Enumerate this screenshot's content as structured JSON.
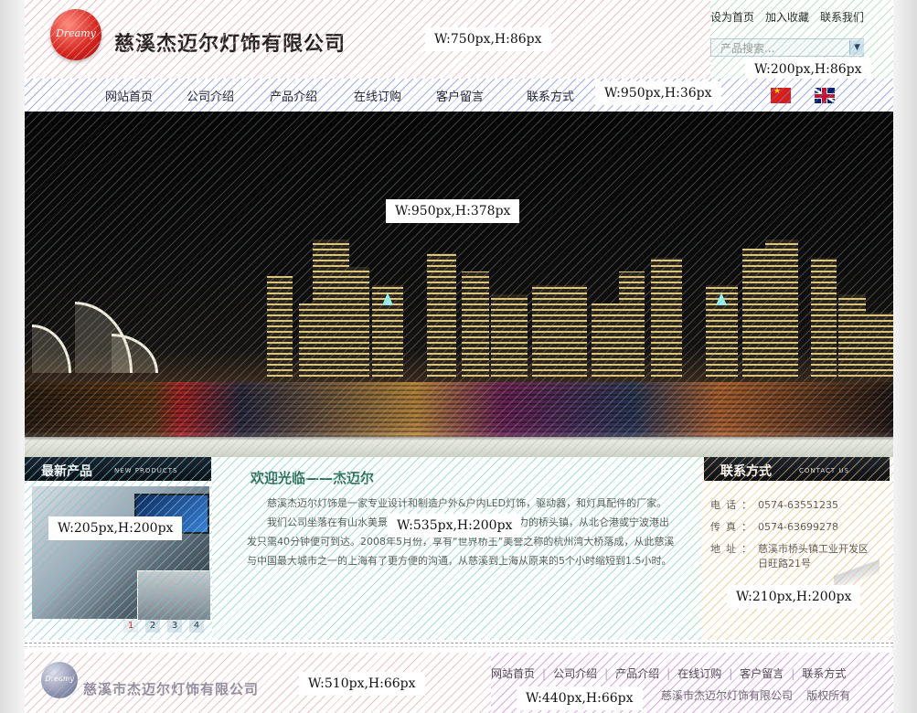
{
  "header": {
    "logo_text": "Dreamy",
    "company": "慈溪杰迈尔灯饰有限公司",
    "dim": "W:750px,H:86px"
  },
  "topbar": {
    "links": [
      "设为首页",
      "加入收藏",
      "联系我们"
    ],
    "search_placeholder": "产品搜索...",
    "dim": "W:200px,H:86px"
  },
  "nav": {
    "items": [
      "网站首页",
      "公司介绍",
      "产品介绍",
      "在线订购",
      "客户留言",
      "联系方式"
    ],
    "dim": "W:950px,H:36px"
  },
  "banner": {
    "dim": "W:950px,H:378px"
  },
  "products": {
    "title": "最新产品",
    "subtitle": "NEW PRODUCTS",
    "pages": [
      "1",
      "2",
      "3",
      "4"
    ],
    "dim": "W:205px,H:200px"
  },
  "welcome": {
    "title": "欢迎光临——杰迈尔",
    "p1": "慈溪杰迈尔灯饰是一家专业设计和制造户外&户内LED灯饰，驱动器，和灯具配件的厂家。",
    "p2": "我们公司坐落在有山水美景的浙江省，慈溪市最有开发潜力的桥头镇，从北仑港或宁波港出发只需40分钟便可到达。2008年5月份，享有“世界桥王”美誉之称的杭州湾大桥落成，从此慈溪与中国最大城市之一的上海有了更方便的沟通，从慈溪到上海从原来的5个小时缩短到1.5小时。",
    "dim": "W:535px,H:200px"
  },
  "contact": {
    "title": "联系方式",
    "subtitle": "CONTACT US",
    "rows": [
      {
        "label": "电话：",
        "value": "0574-63551235"
      },
      {
        "label": "传真：",
        "value": "0574-63699278"
      },
      {
        "label": "地址：",
        "value": "慈溪市桥头镇工业开发区"
      },
      {
        "label": "",
        "value": "日旺路21号"
      }
    ],
    "dim": "W:210px,H:200px"
  },
  "footer": {
    "logo_text": "Dreamy",
    "company": "慈溪市杰迈尔灯饰有限公司",
    "links": [
      "网站首页",
      "公司介绍",
      "产品介绍",
      "在线订购",
      "客户留言",
      "联系方式"
    ],
    "copyright": "慈溪市杰迈尔灯饰有限公司",
    "rights": "版权所有",
    "dim_left": "W:510px,H:66px",
    "dim_right": "W:440px,H:66px"
  }
}
